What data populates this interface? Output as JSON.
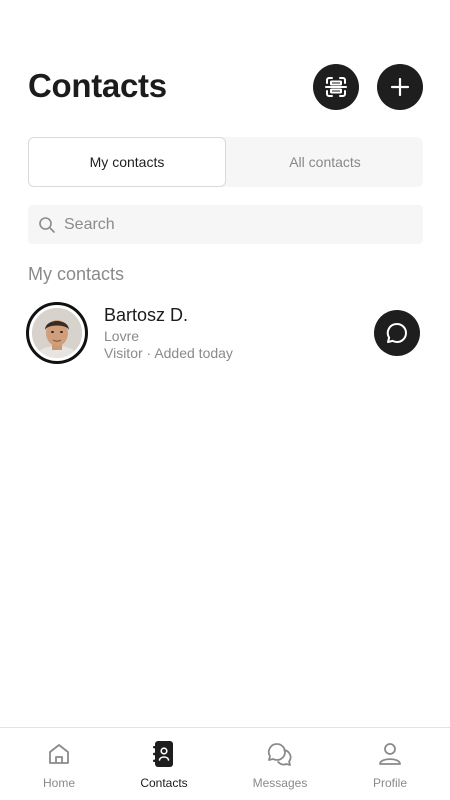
{
  "header": {
    "title": "Contacts",
    "scan_icon": "qr-scan-icon",
    "add_icon": "plus-icon"
  },
  "tabs": [
    {
      "label": "My contacts",
      "active": true
    },
    {
      "label": "All contacts",
      "active": false
    }
  ],
  "search": {
    "placeholder": "Search",
    "value": ""
  },
  "section": {
    "label": "My contacts"
  },
  "contacts": [
    {
      "name": "Bartosz D.",
      "company": "Lovre",
      "meta": "Visitor · Added today",
      "avatar": "user-photo",
      "action_icon": "chat-bubble-icon"
    }
  ],
  "nav": [
    {
      "label": "Home",
      "icon": "home-icon",
      "active": false
    },
    {
      "label": "Contacts",
      "icon": "contacts-book-icon",
      "active": true
    },
    {
      "label": "Messages",
      "icon": "messages-icon",
      "active": false
    },
    {
      "label": "Profile",
      "icon": "profile-icon",
      "active": false
    }
  ],
  "colors": {
    "primary": "#1e1e1e",
    "muted_text": "#8a8a8a",
    "surface": "#f6f6f6",
    "border": "#dadada"
  }
}
